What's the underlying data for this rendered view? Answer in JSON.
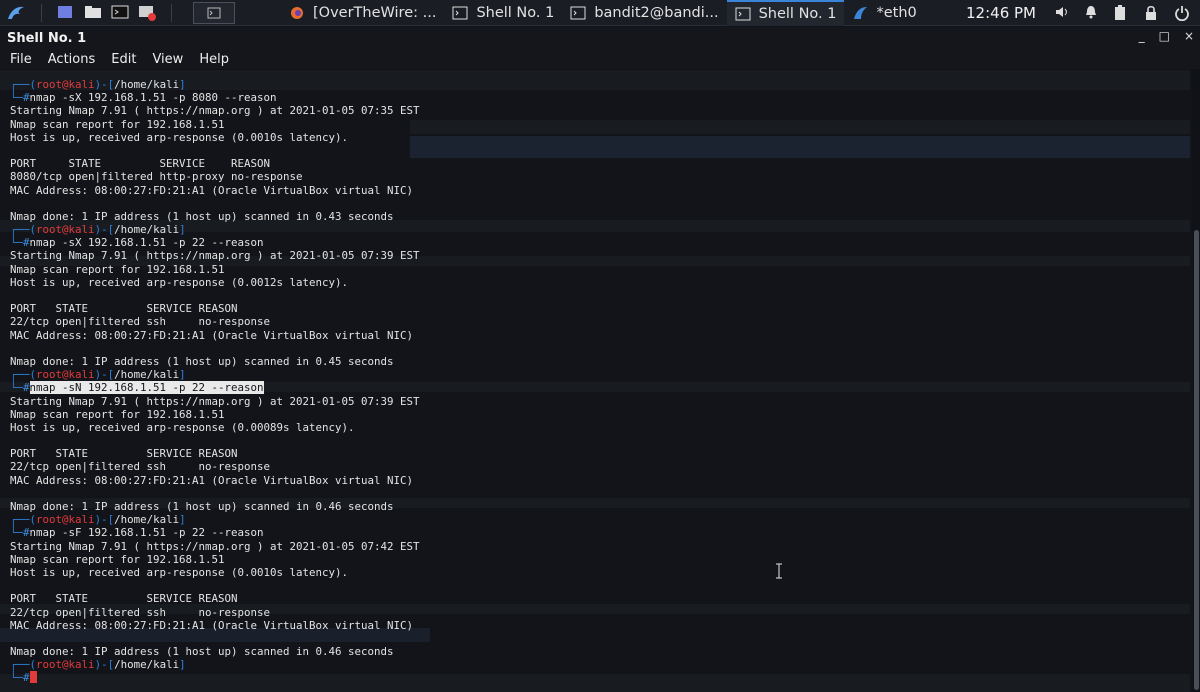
{
  "taskbar": {
    "tasks": [
      {
        "label": "[OverTheWire: ...",
        "icon": "firefox-icon",
        "active": false
      },
      {
        "label": "Shell No. 1",
        "icon": "terminal-icon",
        "active": false
      },
      {
        "label": "bandit2@bandi...",
        "icon": "terminal-icon",
        "active": false
      },
      {
        "label": "Shell No. 1",
        "icon": "terminal-icon",
        "active": true
      },
      {
        "label": "*eth0",
        "icon": "wireshark-icon",
        "active": false
      }
    ],
    "clock": "12:46 PM"
  },
  "window": {
    "title": "Shell No. 1",
    "controls": [
      "_",
      "□",
      "×"
    ],
    "menu": [
      "File",
      "Actions",
      "Edit",
      "View",
      "Help"
    ]
  },
  "terminal": {
    "user": "root",
    "host": "kali",
    "path": "/home/kali",
    "blocks": [
      {
        "command": "nmap -sX 192.168.1.51 -p 8080 --reason",
        "output": [
          "Starting Nmap 7.91 ( https://nmap.org ) at 2021-01-05 07:35 EST",
          "Nmap scan report for 192.168.1.51",
          "Host is up, received arp-response (0.0010s latency).",
          "",
          "PORT     STATE         SERVICE    REASON",
          "8080/tcp open|filtered http-proxy no-response",
          "MAC Address: 08:00:27:FD:21:A1 (Oracle VirtualBox virtual NIC)",
          "",
          "Nmap done: 1 IP address (1 host up) scanned in 0.43 seconds"
        ]
      },
      {
        "command": "nmap -sX 192.168.1.51 -p 22 --reason",
        "output": [
          "Starting Nmap 7.91 ( https://nmap.org ) at 2021-01-05 07:39 EST",
          "Nmap scan report for 192.168.1.51",
          "Host is up, received arp-response (0.0012s latency).",
          "",
          "PORT   STATE         SERVICE REASON",
          "22/tcp open|filtered ssh     no-response",
          "MAC Address: 08:00:27:FD:21:A1 (Oracle VirtualBox virtual NIC)",
          "",
          "Nmap done: 1 IP address (1 host up) scanned in 0.45 seconds"
        ]
      },
      {
        "command": "nmap -sN 192.168.1.51 -p 22 --reason",
        "highlighted": true,
        "output": [
          "Starting Nmap 7.91 ( https://nmap.org ) at 2021-01-05 07:39 EST",
          "Nmap scan report for 192.168.1.51",
          "Host is up, received arp-response (0.00089s latency).",
          "",
          "PORT   STATE         SERVICE REASON",
          "22/tcp open|filtered ssh     no-response",
          "MAC Address: 08:00:27:FD:21:A1 (Oracle VirtualBox virtual NIC)",
          "",
          "Nmap done: 1 IP address (1 host up) scanned in 0.46 seconds"
        ]
      },
      {
        "command": "nmap -sF 192.168.1.51 -p 22 --reason",
        "output": [
          "Starting Nmap 7.91 ( https://nmap.org ) at 2021-01-05 07:42 EST",
          "Nmap scan report for 192.168.1.51",
          "Host is up, received arp-response (0.0010s latency).",
          "",
          "PORT   STATE         SERVICE REASON",
          "22/tcp open|filtered ssh     no-response",
          "MAC Address: 08:00:27:FD:21:A1 (Oracle VirtualBox virtual NIC)",
          "",
          "Nmap done: 1 IP address (1 host up) scanned in 0.46 seconds"
        ]
      }
    ]
  },
  "colors": {
    "prompt_frame": "#2f7fd8",
    "prompt_user": "#e13b3b",
    "background": "#121419",
    "accent": "#3c84d8"
  }
}
